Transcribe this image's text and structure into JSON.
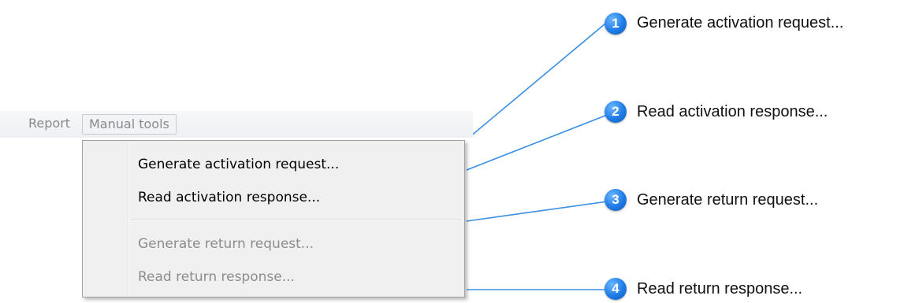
{
  "menubar": {
    "items": [
      {
        "label": "Report"
      },
      {
        "label": "Manual tools"
      }
    ]
  },
  "dropdown": {
    "items": [
      {
        "label": "Generate activation request...",
        "enabled": true
      },
      {
        "label": "Read activation response...",
        "enabled": true
      },
      {
        "label": "Generate return request...",
        "enabled": false
      },
      {
        "label": "Read return response...",
        "enabled": false
      }
    ]
  },
  "callouts": [
    {
      "number": "1",
      "text": "Generate activation request..."
    },
    {
      "number": "2",
      "text": "Read activation response..."
    },
    {
      "number": "3",
      "text": "Generate return request..."
    },
    {
      "number": "4",
      "text": "Read return response..."
    }
  ],
  "colors": {
    "callout_badge": "#1f7be6",
    "connector_line": "#3b8fe3",
    "disabled_text": "#8d8d8d"
  }
}
